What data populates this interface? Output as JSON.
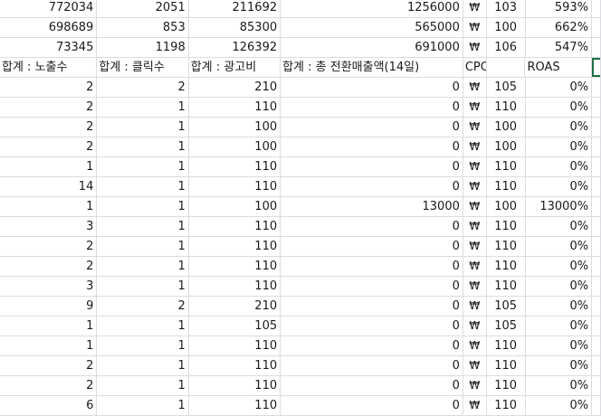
{
  "spreadsheet": {
    "top_rows": [
      [
        "772034",
        "2051",
        "211692",
        "1256000",
        "₩",
        "103",
        "593%"
      ],
      [
        "698689",
        "853",
        "85300",
        "565000",
        "₩",
        "100",
        "662%"
      ],
      [
        "73345",
        "1198",
        "126392",
        "691000",
        "₩",
        "106",
        "547%"
      ]
    ],
    "headers": [
      "합계 : 노출수",
      "합계 : 클릭수",
      "합계 : 광고비",
      "합계 : 총 전환매출액(14일)",
      "CPC",
      "",
      "ROAS"
    ],
    "rows": [
      [
        "2",
        "2",
        "210",
        "0",
        "₩",
        "105",
        "0%"
      ],
      [
        "2",
        "1",
        "110",
        "0",
        "₩",
        "110",
        "0%"
      ],
      [
        "2",
        "1",
        "100",
        "0",
        "₩",
        "100",
        "0%"
      ],
      [
        "2",
        "1",
        "100",
        "0",
        "₩",
        "100",
        "0%"
      ],
      [
        "1",
        "1",
        "110",
        "0",
        "₩",
        "110",
        "0%"
      ],
      [
        "14",
        "1",
        "110",
        "0",
        "₩",
        "110",
        "0%"
      ],
      [
        "1",
        "1",
        "100",
        "13000",
        "₩",
        "100",
        "13000%"
      ],
      [
        "3",
        "1",
        "110",
        "0",
        "₩",
        "110",
        "0%"
      ],
      [
        "2",
        "1",
        "110",
        "0",
        "₩",
        "110",
        "0%"
      ],
      [
        "2",
        "1",
        "110",
        "0",
        "₩",
        "110",
        "0%"
      ],
      [
        "3",
        "1",
        "110",
        "0",
        "₩",
        "110",
        "0%"
      ],
      [
        "9",
        "2",
        "210",
        "0",
        "₩",
        "105",
        "0%"
      ],
      [
        "1",
        "1",
        "105",
        "0",
        "₩",
        "105",
        "0%"
      ],
      [
        "1",
        "1",
        "110",
        "0",
        "₩",
        "110",
        "0%"
      ],
      [
        "2",
        "1",
        "110",
        "0",
        "₩",
        "110",
        "0%"
      ],
      [
        "2",
        "1",
        "110",
        "0",
        "₩",
        "110",
        "0%"
      ],
      [
        "6",
        "1",
        "110",
        "0",
        "₩",
        "110",
        "0%"
      ]
    ]
  },
  "colors": {
    "gridline": "#dadcdf",
    "selection": "#1e7145"
  }
}
